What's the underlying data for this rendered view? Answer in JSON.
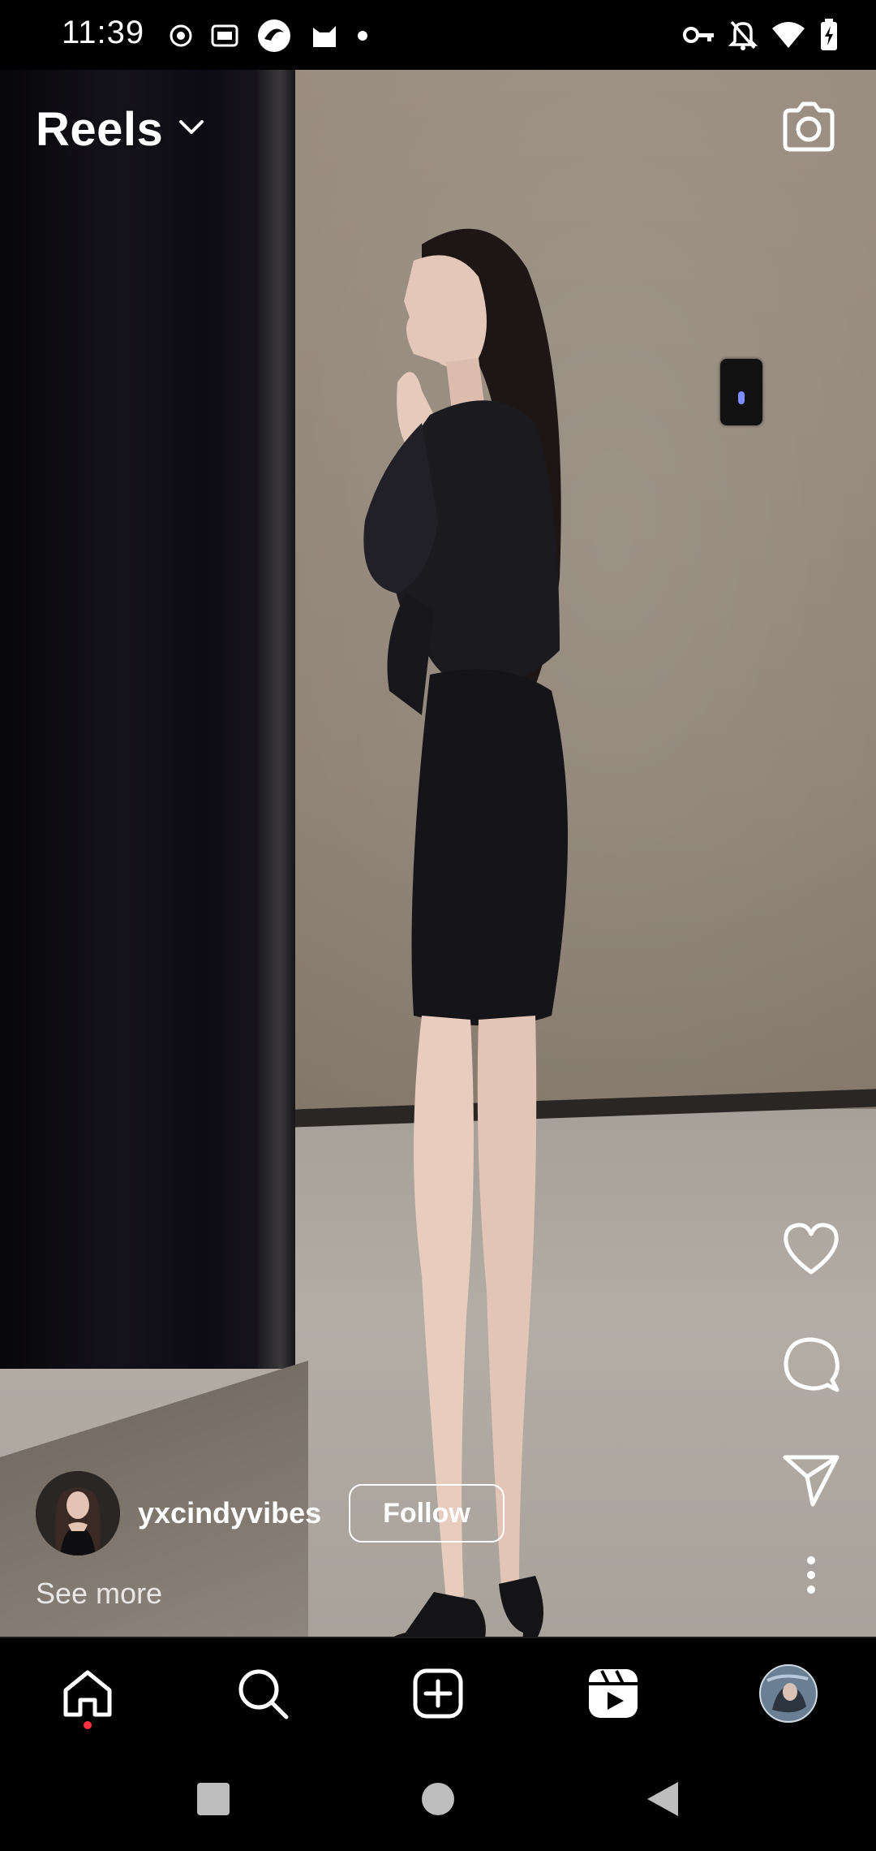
{
  "status_bar": {
    "time": "11:39",
    "left_icons": [
      "record-icon",
      "iqiyi-icon",
      "app-swirl-icon",
      "cat-app-icon",
      "dot-icon"
    ],
    "right_icons": [
      "vpn-key-icon",
      "notifications-off-icon",
      "wifi-icon",
      "battery-charging-icon"
    ]
  },
  "header": {
    "title": "Reels",
    "dropdown_icon": "chevron-down-icon",
    "camera_icon": "camera-icon"
  },
  "actions": {
    "like_icon": "heart-icon",
    "comment_icon": "comment-icon",
    "share_icon": "send-icon",
    "more_icon": "more-vertical-icon"
  },
  "author": {
    "username": "yxcindyvibes",
    "follow_label": "Follow",
    "see_more": "See more"
  },
  "nav": {
    "items": [
      "home-icon",
      "search-icon",
      "create-icon",
      "reels-icon",
      "profile-avatar"
    ],
    "active": "reels-icon",
    "home_notification_color": "#ff3040"
  },
  "system_nav": [
    "recents-square-icon",
    "home-circle-icon",
    "back-triangle-icon"
  ]
}
